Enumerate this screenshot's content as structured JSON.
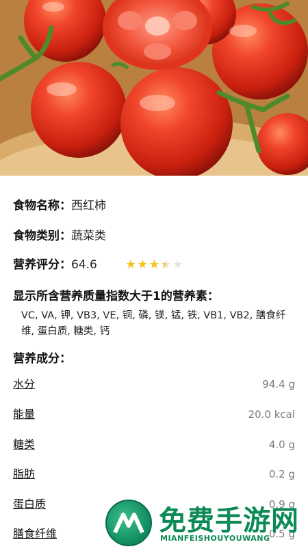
{
  "food": {
    "name_label": "食物名称：",
    "name_value": "西红柿",
    "category_label": "食物类别：",
    "category_value": "蔬菜类",
    "score_label": "营养评分：",
    "score_value": "64.6",
    "score_stars": 3.5,
    "score_stars_max": 5
  },
  "quality": {
    "heading": "显示所含营养质量指数大于1的营养素：",
    "nutrients": "VC, VA, 钾, VB3, VE, 铜, 磷, 镁, 锰, 铁, VB1, VB2, 膳食纤维, 蛋白质, 糖类, 钙"
  },
  "composition": {
    "heading": "营养成分：",
    "rows": [
      {
        "name": "水分",
        "amount": "94.4 g"
      },
      {
        "name": "能量",
        "amount": "20.0 kcal"
      },
      {
        "name": "糖类",
        "amount": "4.0 g"
      },
      {
        "name": "脂肪",
        "amount": "0.2 g"
      },
      {
        "name": "蛋白质",
        "amount": "0.9 g"
      },
      {
        "name": "膳食纤维",
        "amount": "0.5 g"
      }
    ]
  },
  "watermark": {
    "title": "免费手游网",
    "subtitle": "MIANFEISHOUYOUWANG"
  },
  "colors": {
    "accent": "#4a9fc4",
    "star": "#f3c519",
    "star_empty": "#e4e4e4",
    "amount": "#7a7a7a",
    "watermark": "#0c8a56"
  }
}
